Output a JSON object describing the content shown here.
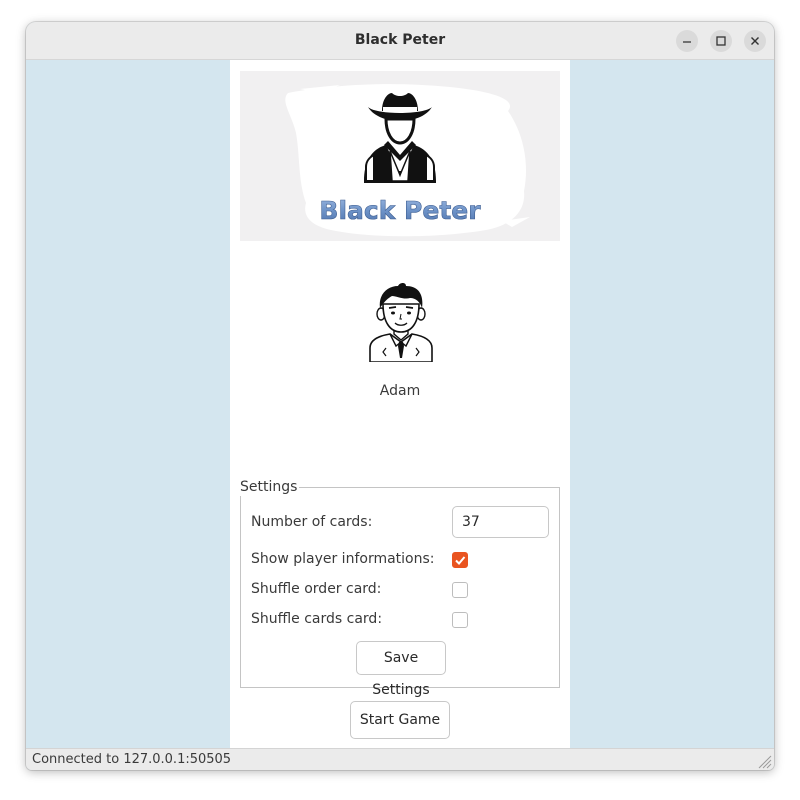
{
  "window": {
    "title": "Black Peter"
  },
  "banner": {
    "logo_text": "Black Peter"
  },
  "player": {
    "name": "Adam"
  },
  "settings": {
    "legend": "Settings",
    "number_of_cards_label": "Number of cards:",
    "number_of_cards_value": "37",
    "show_player_info_label": "Show player informations:",
    "show_player_info_checked": true,
    "shuffle_order_label": "Shuffle order card:",
    "shuffle_order_checked": false,
    "shuffle_cards_label": "Shuffle cards card:",
    "shuffle_cards_checked": false,
    "save_button_label": "Save Settings"
  },
  "actions": {
    "start_game_label": "Start Game"
  },
  "status": {
    "text": "Connected to 127.0.0.1:50505"
  },
  "colors": {
    "accent": "#e95420",
    "window_background": "#d4e6ef",
    "logo_text": "#6e93c8"
  }
}
